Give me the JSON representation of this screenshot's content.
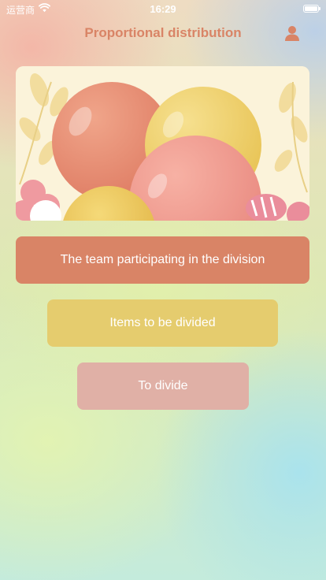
{
  "status_bar": {
    "carrier": "运营商",
    "time": "16:29",
    "wifi_icon": "wifi-icon",
    "battery_icon": "battery-icon"
  },
  "nav": {
    "title": "Proportional distribution",
    "user_icon": "user-icon"
  },
  "banner": {
    "image": "balloons-illustration"
  },
  "buttons": {
    "team": "The team participating in the division",
    "items": "Items to be divided",
    "divide": "To divide"
  },
  "colors": {
    "accent": "#d98466",
    "team_button": "#d98466",
    "items_button": "#e5cc6e",
    "divide_button": "#e0b0a6"
  }
}
